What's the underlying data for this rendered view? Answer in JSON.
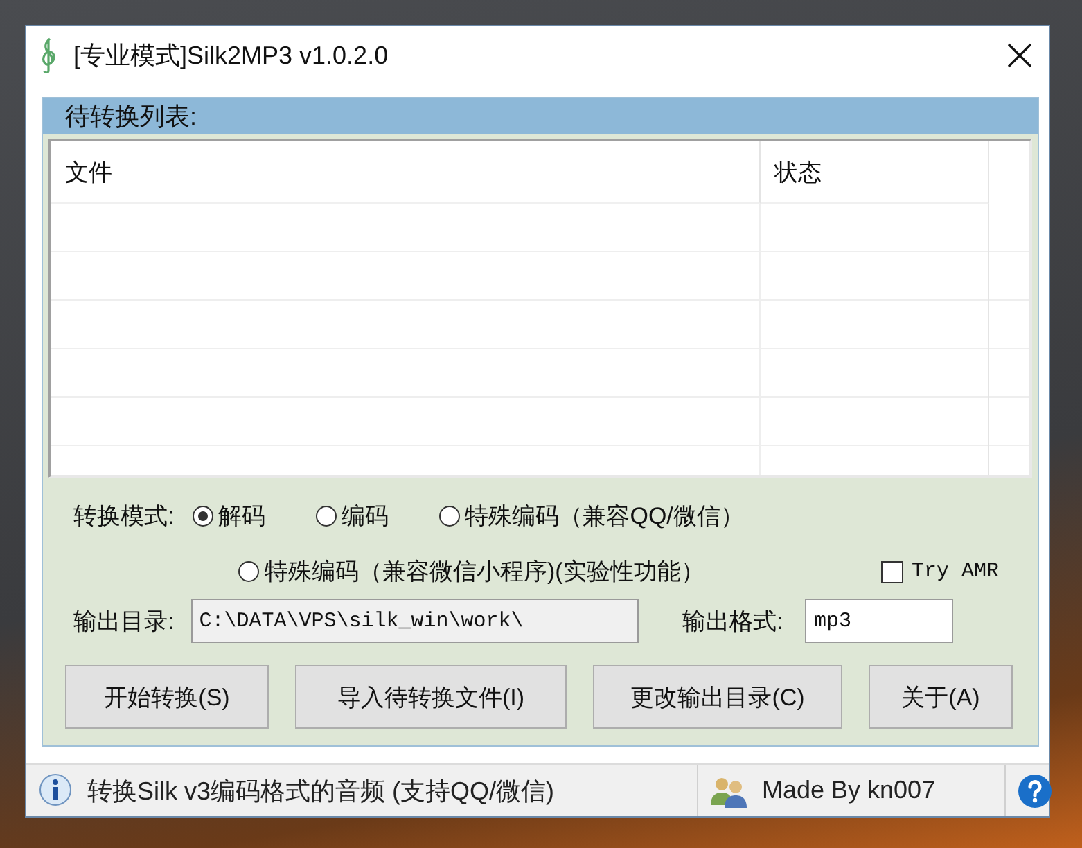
{
  "window": {
    "title": "[专业模式]Silk2MP3 v1.0.2.0"
  },
  "list": {
    "title": "待转换列表:",
    "columns": [
      "文件",
      "状态"
    ]
  },
  "mode": {
    "label": "转换模式:",
    "options": [
      {
        "label": "解码",
        "selected": true
      },
      {
        "label": "编码",
        "selected": false
      },
      {
        "label": "特殊编码（兼容QQ/微信）",
        "selected": false
      },
      {
        "label": "特殊编码（兼容微信小程序)(实验性功能）",
        "selected": false
      }
    ]
  },
  "try_amr": {
    "label": "Try AMR",
    "checked": false
  },
  "output_dir": {
    "label": "输出目录:",
    "value": "C:\\DATA\\VPS\\silk_win\\work\\"
  },
  "output_format": {
    "label": "输出格式:",
    "value": "mp3"
  },
  "buttons": [
    "开始转换(S)",
    "导入待转换文件(I)",
    "更改输出目录(C)",
    "关于(A)"
  ],
  "status_bar": {
    "message": "转换Silk v3编码格式的音频 (支持QQ/微信)",
    "author": "Made By kn007"
  }
}
